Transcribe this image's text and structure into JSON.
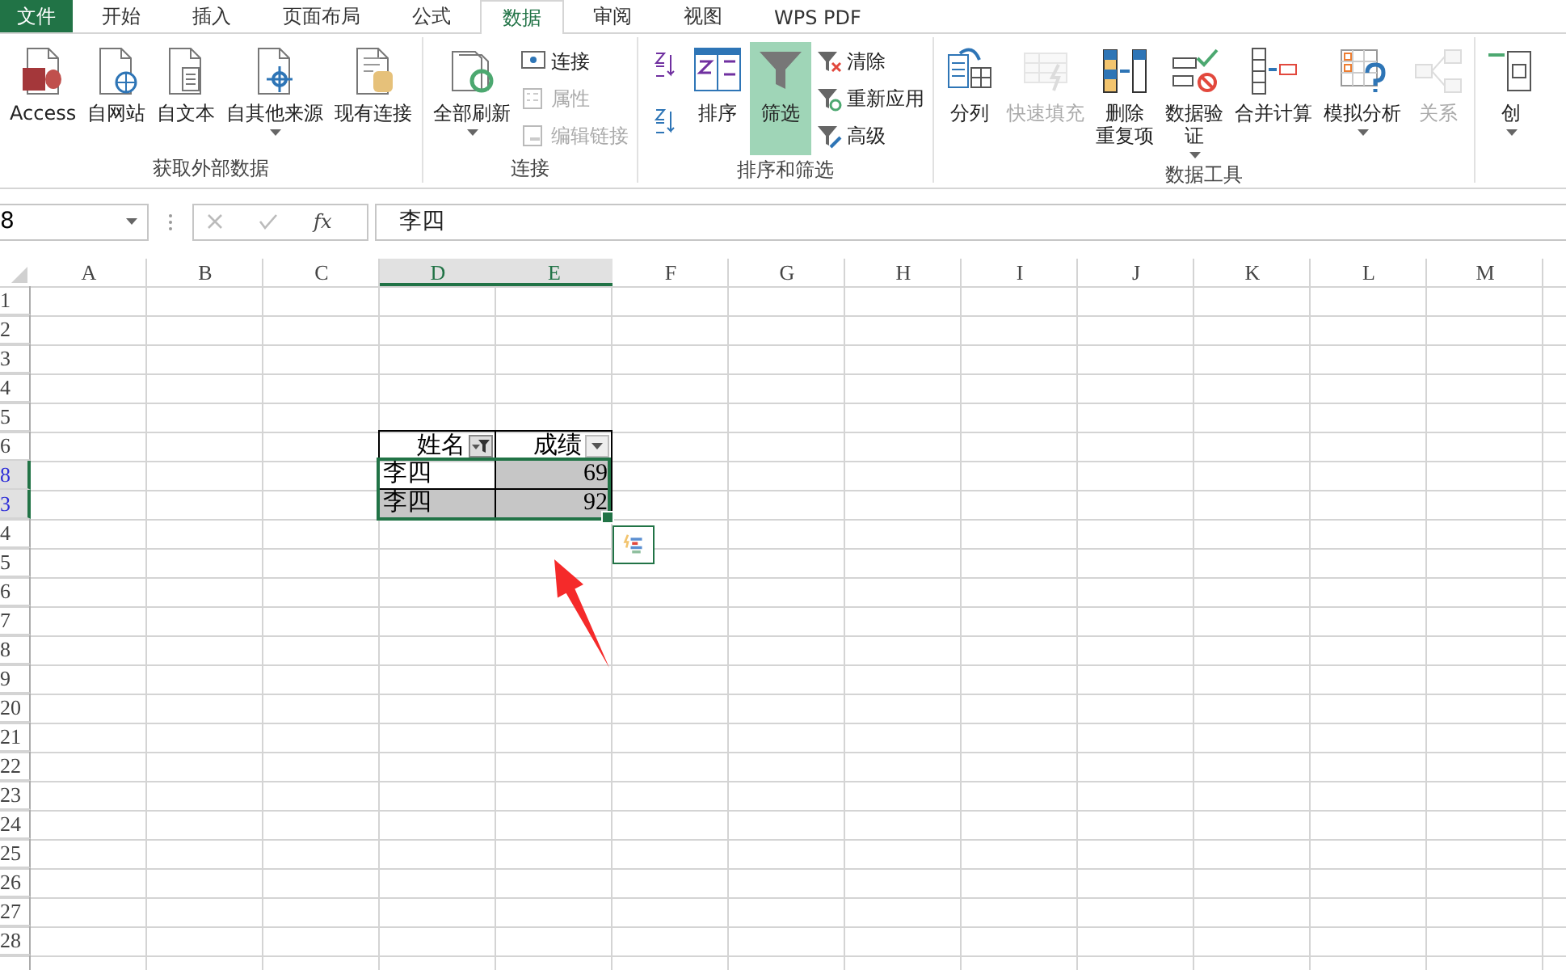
{
  "menu_tabs": {
    "file_tab": "文件",
    "tabs": [
      {
        "label": "开始",
        "selected": false
      },
      {
        "label": "插入",
        "selected": false
      },
      {
        "label": "页面布局",
        "selected": false
      },
      {
        "label": "公式",
        "selected": false
      },
      {
        "label": "数据",
        "selected": true
      },
      {
        "label": "审阅",
        "selected": false
      },
      {
        "label": "视图",
        "selected": false
      },
      {
        "label": "WPS PDF",
        "selected": false
      }
    ]
  },
  "ribbon": {
    "groups": [
      {
        "label": "获取外部数据",
        "items": [
          {
            "kind": "large",
            "label": "Access",
            "disabled": false,
            "dropdown": false,
            "on": false
          },
          {
            "kind": "large",
            "label": "自网站",
            "disabled": false,
            "dropdown": false,
            "on": false
          },
          {
            "kind": "large",
            "label": "自文本",
            "disabled": false,
            "dropdown": false,
            "on": false
          },
          {
            "kind": "large",
            "label": "自其他来源",
            "disabled": false,
            "dropdown": true,
            "on": false
          },
          {
            "kind": "large",
            "label": "现有连接",
            "disabled": false,
            "dropdown": false,
            "on": false
          }
        ]
      },
      {
        "label": "连接",
        "items": [
          {
            "kind": "large",
            "label": "全部刷新",
            "disabled": false,
            "dropdown": true,
            "on": false
          },
          {
            "kind": "small",
            "label": "连接",
            "disabled": false,
            "dropdown": false,
            "on": false
          },
          {
            "kind": "small",
            "label": "属性",
            "disabled": true,
            "dropdown": false,
            "on": false
          },
          {
            "kind": "small",
            "label": "编辑链接",
            "disabled": true,
            "dropdown": false,
            "on": false
          }
        ]
      },
      {
        "label": "排序和筛选",
        "items": [
          {
            "kind": "icon",
            "disabled": false,
            "dropdown": false,
            "on": false
          },
          {
            "kind": "icon",
            "disabled": false,
            "dropdown": false,
            "on": false
          },
          {
            "kind": "large",
            "label": "排序",
            "disabled": false,
            "dropdown": false,
            "on": false
          },
          {
            "kind": "large",
            "label": "筛选",
            "disabled": false,
            "dropdown": false,
            "on": true
          },
          {
            "kind": "small",
            "label": "清除",
            "disabled": false,
            "dropdown": false,
            "on": false
          },
          {
            "kind": "small",
            "label": "重新应用",
            "disabled": false,
            "dropdown": false,
            "on": false
          },
          {
            "kind": "small",
            "label": "高级",
            "disabled": false,
            "dropdown": false,
            "on": false
          }
        ]
      },
      {
        "label": "数据工具",
        "items": [
          {
            "kind": "large",
            "label": "分列",
            "disabled": false,
            "dropdown": false,
            "on": false
          },
          {
            "kind": "large",
            "label": "快速填充",
            "disabled": true,
            "dropdown": false,
            "on": false
          },
          {
            "kind": "large",
            "label_lines": [
              "删除",
              "重复项"
            ],
            "disabled": false,
            "dropdown": false,
            "on": false
          },
          {
            "kind": "large",
            "label_lines": [
              "数据验",
              "证"
            ],
            "disabled": false,
            "dropdown": true,
            "on": false
          },
          {
            "kind": "large",
            "label": "合并计算",
            "disabled": false,
            "dropdown": false,
            "on": false
          },
          {
            "kind": "large",
            "label": "模拟分析",
            "disabled": false,
            "dropdown": true,
            "on": false
          },
          {
            "kind": "large",
            "label": "关系",
            "disabled": true,
            "dropdown": false,
            "on": false
          }
        ]
      },
      {
        "items": [
          {
            "kind": "large",
            "label": "创",
            "disabled": false,
            "dropdown": true,
            "on": false
          }
        ]
      }
    ]
  },
  "formula_bar": {
    "name_box": "8",
    "function_button": "fx",
    "formula": "李四"
  },
  "sheet": {
    "columns": [
      {
        "label": "A",
        "selected": false
      },
      {
        "label": "B",
        "selected": false
      },
      {
        "label": "C",
        "selected": false
      },
      {
        "label": "D",
        "selected": true
      },
      {
        "label": "E",
        "selected": true
      },
      {
        "label": "F",
        "selected": false
      },
      {
        "label": "G",
        "selected": false
      },
      {
        "label": "H",
        "selected": false
      },
      {
        "label": "I",
        "selected": false
      },
      {
        "label": "J",
        "selected": false
      },
      {
        "label": "K",
        "selected": false
      },
      {
        "label": "L",
        "selected": false
      },
      {
        "label": "M",
        "selected": false
      }
    ],
    "rows": [
      {
        "label": "1",
        "selected": false,
        "filtered": false
      },
      {
        "label": "2",
        "selected": false,
        "filtered": false
      },
      {
        "label": "3",
        "selected": false,
        "filtered": false
      },
      {
        "label": "4",
        "selected": false,
        "filtered": false
      },
      {
        "label": "5",
        "selected": false,
        "filtered": false
      },
      {
        "label": "6",
        "selected": false,
        "filtered": false
      },
      {
        "label": "8",
        "selected": true,
        "filtered": true
      },
      {
        "label": "3",
        "selected": true,
        "filtered": true
      },
      {
        "label": "4",
        "selected": false,
        "filtered": false
      },
      {
        "label": "5",
        "selected": false,
        "filtered": false
      },
      {
        "label": "6",
        "selected": false,
        "filtered": false
      },
      {
        "label": "7",
        "selected": false,
        "filtered": false
      },
      {
        "label": "8",
        "selected": false,
        "filtered": false
      },
      {
        "label": "9",
        "selected": false,
        "filtered": false
      },
      {
        "label": "20",
        "selected": false,
        "filtered": false
      },
      {
        "label": "21",
        "selected": false,
        "filtered": false
      },
      {
        "label": "22",
        "selected": false,
        "filtered": false
      },
      {
        "label": "23",
        "selected": false,
        "filtered": false
      },
      {
        "label": "24",
        "selected": false,
        "filtered": false
      },
      {
        "label": "25",
        "selected": false,
        "filtered": false
      },
      {
        "label": "26",
        "selected": false,
        "filtered": false
      },
      {
        "label": "27",
        "selected": false,
        "filtered": false
      },
      {
        "label": "28",
        "selected": false,
        "filtered": false
      }
    ],
    "table": {
      "headers": [
        {
          "text": "姓名",
          "filter_active": true
        },
        {
          "text": "成绩",
          "filter_active": false
        }
      ],
      "rows": [
        {
          "cells": [
            {
              "text": "李四",
              "highlighted": false
            },
            {
              "text": "69",
              "highlighted": true
            }
          ]
        },
        {
          "cells": [
            {
              "text": "李四",
              "highlighted": true
            },
            {
              "text": "92",
              "highlighted": true
            }
          ]
        }
      ]
    }
  }
}
